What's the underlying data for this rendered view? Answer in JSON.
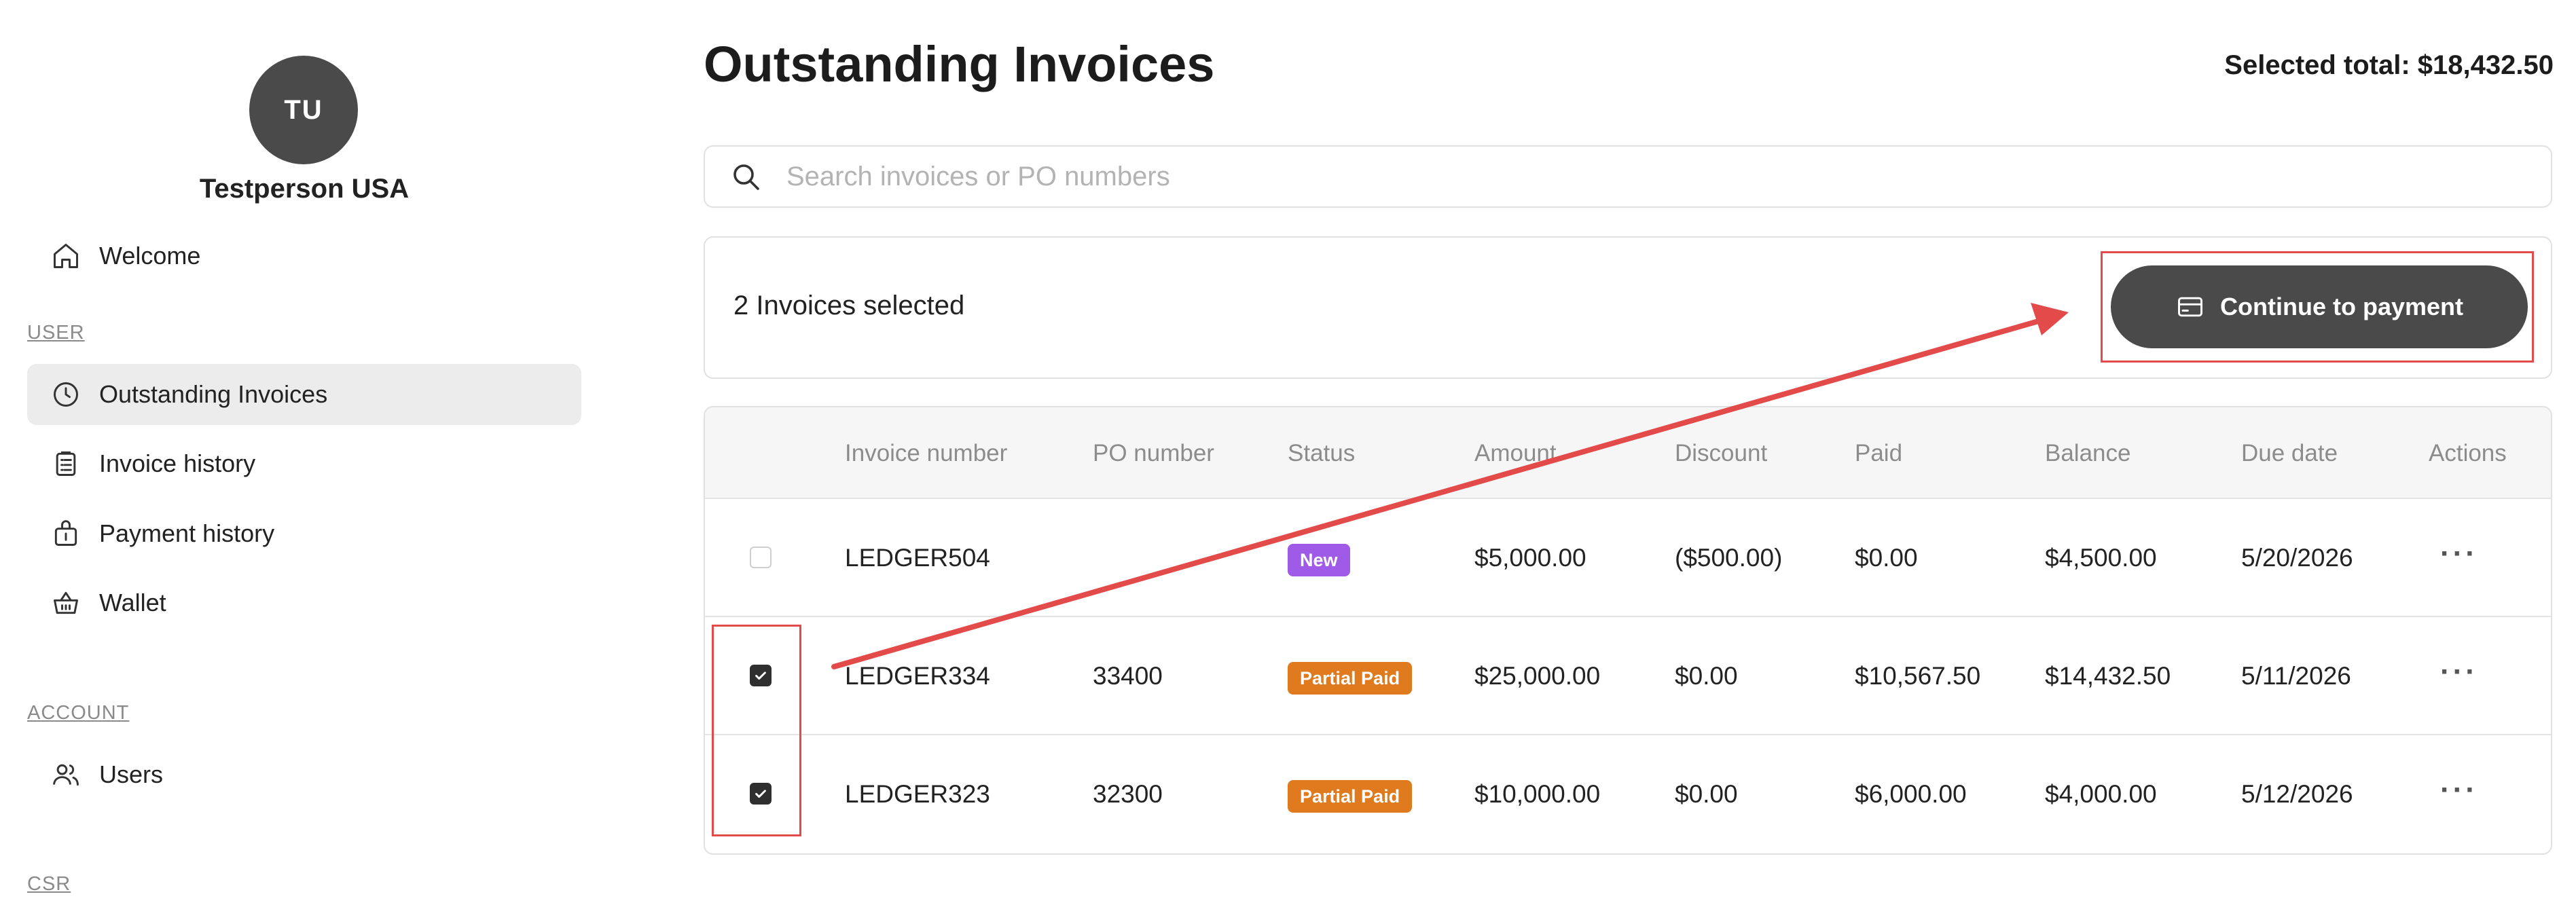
{
  "profile": {
    "initials": "TU",
    "name": "Testperson USA"
  },
  "sidebar": {
    "welcome": {
      "label": "Welcome",
      "icon": "home-icon"
    },
    "sections": [
      {
        "label": "USER",
        "items": [
          {
            "label": "Outstanding Invoices",
            "icon": "clock-icon",
            "active": true
          },
          {
            "label": "Invoice history",
            "icon": "clipboard-icon",
            "active": false
          },
          {
            "label": "Payment history",
            "icon": "bag-icon",
            "active": false
          },
          {
            "label": "Wallet",
            "icon": "basket-icon",
            "active": false
          }
        ]
      },
      {
        "label": "ACCOUNT",
        "items": [
          {
            "label": "Users",
            "icon": "users-icon",
            "active": false
          }
        ]
      },
      {
        "label": "CSR",
        "items": []
      }
    ]
  },
  "main": {
    "title": "Outstanding Invoices",
    "selected_total": "Selected total: $18,432.50",
    "search": {
      "placeholder": "Search invoices or PO numbers",
      "value": ""
    },
    "selection": {
      "text": "2 Invoices selected",
      "button_label": "Continue to payment"
    },
    "table": {
      "columns": [
        "Invoice number",
        "PO number",
        "Status",
        "Amount",
        "Discount",
        "Paid",
        "Balance",
        "Due date",
        "Actions"
      ],
      "rows": [
        {
          "checked": false,
          "invoice": "LEDGER504",
          "po": "",
          "status": "New",
          "status_color": "#a05ae8",
          "amount": "$5,000.00",
          "discount": "($500.00)",
          "paid": "$0.00",
          "balance": "$4,500.00",
          "due": "5/20/2026",
          "actions": "···"
        },
        {
          "checked": true,
          "invoice": "LEDGER334",
          "po": "33400",
          "status": "Partial Paid",
          "status_color": "#e07a1f",
          "amount": "$25,000.00",
          "discount": "$0.00",
          "paid": "$10,567.50",
          "balance": "$14,432.50",
          "due": "5/11/2026",
          "actions": "···"
        },
        {
          "checked": true,
          "invoice": "LEDGER323",
          "po": "32300",
          "status": "Partial Paid",
          "status_color": "#e07a1f",
          "amount": "$10,000.00",
          "discount": "$0.00",
          "paid": "$6,000.00",
          "balance": "$4,000.00",
          "due": "5/12/2026",
          "actions": "···"
        }
      ]
    }
  },
  "colors": {
    "accent_dark": "#4a4a4a",
    "annotation_red": "#e34a4a",
    "badge_new": "#a05ae8",
    "badge_partial": "#e07a1f"
  }
}
